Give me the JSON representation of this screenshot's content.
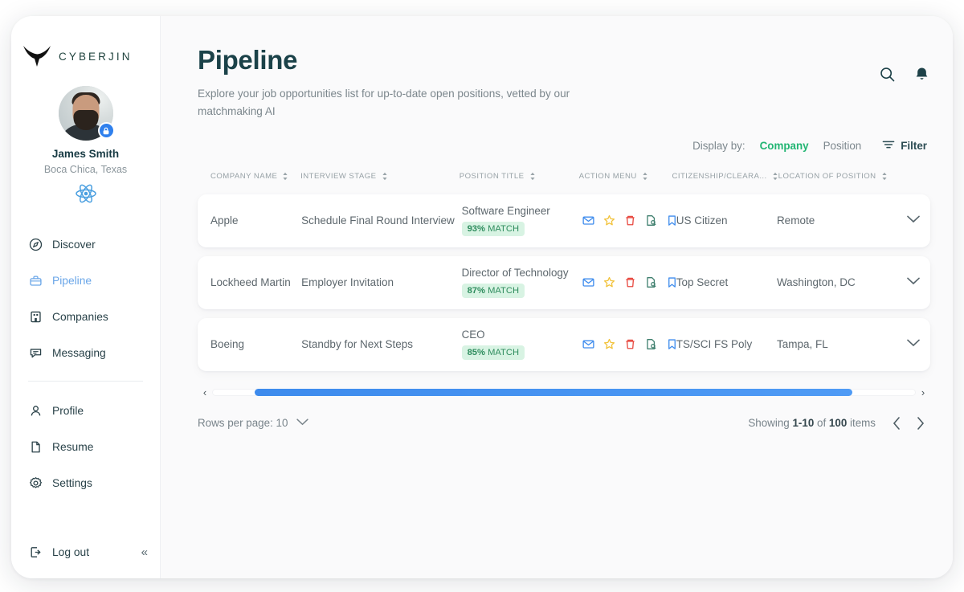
{
  "brand": {
    "name": "CYBERJIN",
    "logo_icon": "cyberjin-bull-logo"
  },
  "profile": {
    "name": "James Smith",
    "location": "Boca Chica, Texas",
    "badge_icon": "lock-badge-icon",
    "atom_icon": "atom-icon",
    "avatar_name": "user-avatar"
  },
  "sidebar": {
    "items": [
      {
        "label": "Discover",
        "icon": "compass-icon",
        "active": false
      },
      {
        "label": "Pipeline",
        "icon": "briefcase-icon",
        "active": true
      },
      {
        "label": "Companies",
        "icon": "building-icon",
        "active": false
      },
      {
        "label": "Messaging",
        "icon": "chat-icon",
        "active": false
      }
    ],
    "items_secondary": [
      {
        "label": "Profile",
        "icon": "person-icon"
      },
      {
        "label": "Resume",
        "icon": "file-icon"
      },
      {
        "label": "Settings",
        "icon": "gear-icon"
      }
    ],
    "logout": {
      "label": "Log out",
      "icon": "logout-icon"
    },
    "collapse_icon": "chevrons-left-icon"
  },
  "header": {
    "title": "Pipeline",
    "subtitle": "Explore your job opportunities list for up-to-date open positions, vetted by our matchmaking AI",
    "search_icon": "search-icon",
    "bell_icon": "notification-bell-icon"
  },
  "controls": {
    "display_by_label": "Display by:",
    "options": [
      {
        "label": "Company",
        "active": true
      },
      {
        "label": "Position",
        "active": false
      }
    ],
    "filter_label": "Filter",
    "filter_icon": "filter-icon",
    "accent_green": "#22b573"
  },
  "table": {
    "columns": [
      {
        "label": "COMPANY NAME"
      },
      {
        "label": "INTERVIEW STAGE"
      },
      {
        "label": "POSITION TITLE"
      },
      {
        "label": "ACTION MENU"
      },
      {
        "label": "CITIZENSHIP/CLEARA..."
      },
      {
        "label": "LOCATION OF POSITION"
      }
    ],
    "action_icons": [
      {
        "name": "email-icon",
        "color": "#3d8bed"
      },
      {
        "name": "star-icon",
        "color": "#f2c33d"
      },
      {
        "name": "trash-icon",
        "color": "#e8483f"
      },
      {
        "name": "document-search-icon",
        "color": "#3f7f6e"
      },
      {
        "name": "bookmark-icon",
        "color": "#3d8bed"
      }
    ],
    "rows": [
      {
        "company": "Apple",
        "stage": "Schedule Final Round Interview",
        "position": "Software Engineer",
        "match_pct": "93%",
        "match_word": "MATCH",
        "citizenship": "US Citizen",
        "location": "Remote",
        "expand_icon": "chevron-down-icon"
      },
      {
        "company": "Lockheed Martin",
        "stage": "Employer Invitation",
        "position": "Director of Technology",
        "match_pct": "87%",
        "match_word": "MATCH",
        "citizenship": "Top Secret",
        "location": "Washington, DC",
        "expand_icon": "chevron-down-icon"
      },
      {
        "company": "Boeing",
        "stage": "Standby for Next Steps",
        "position": "CEO",
        "match_pct": "85%",
        "match_word": "MATCH",
        "citizenship": "TS/SCI FS Poly",
        "location": "Tampa, FL",
        "expand_icon": "chevron-down-icon"
      }
    ]
  },
  "footer": {
    "rows_per_page_label": "Rows per page: 10",
    "showing_prefix": "Showing",
    "showing_range": "1-10",
    "showing_mid": "of",
    "showing_total": "100",
    "showing_suffix": "items",
    "prev_icon": "chevron-left-icon",
    "next_icon": "chevron-right-icon"
  }
}
